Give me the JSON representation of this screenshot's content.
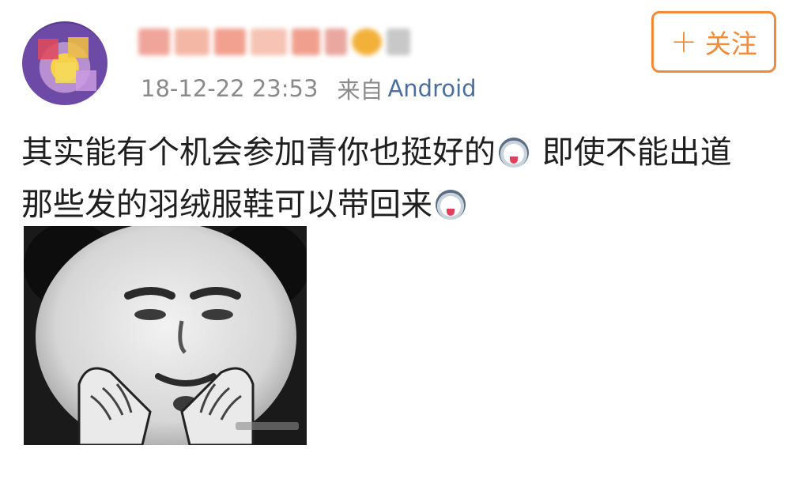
{
  "header": {
    "timestamp": "18-12-22 23:53",
    "from_label": "来自",
    "source": "Android",
    "follow_label": "关注"
  },
  "post": {
    "line1_a": "其实能有个机会参加青你也挺好的",
    "line1_emoji": "panda-tongue-emoji",
    "line1_b": " 即使不能出道",
    "line2_a": "那些发的羽绒服鞋可以带回来",
    "line2_emoji": "panda-tongue-emoji"
  },
  "colors": {
    "accent_orange": "#f08b3c",
    "link_blue": "#4a6f9c",
    "meta_gray": "#8a8a8a"
  },
  "icons": {
    "follow": "plus-icon",
    "avatar": "avatar-image",
    "meme": "panda-meme-image"
  }
}
